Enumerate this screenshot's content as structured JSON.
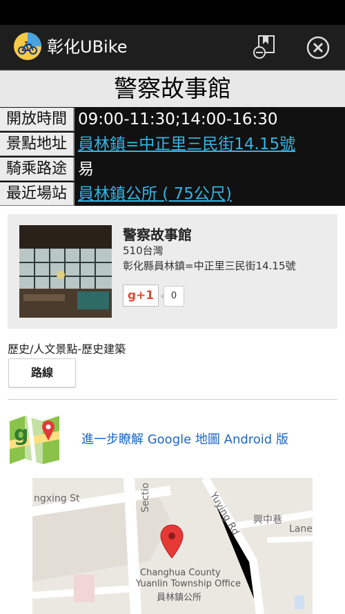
{
  "app": {
    "title": "彰化UBike"
  },
  "icons": {
    "app": "bicycle-app-icon",
    "bookmark": "bookmark-remove-icon",
    "close": "close-circle-icon",
    "maps": "google-maps-icon",
    "pin": "map-pin-icon"
  },
  "header": {
    "title": "警察故事館"
  },
  "info": {
    "rows": [
      {
        "label": "開放時間",
        "value": "09:00-11:30;14:00-16:30"
      },
      {
        "label": "景點地址",
        "value": "員林鎮=中正里三民街14.15號"
      },
      {
        "label": "騎乘路途",
        "value": "易"
      },
      {
        "label": "最近場站",
        "value": "員林鎮公所 ( 75公尺)"
      }
    ]
  },
  "card": {
    "name": "警察故事館",
    "zip": "510台灣",
    "address": "彰化縣員林鎮=中正里三民街14.15號",
    "gplus_label": "g+1",
    "gplus_count": "0"
  },
  "category": "歷史/人文景點-歷史建築",
  "route_button": "路線",
  "maps_link": "進一步瞭解 Google 地圖 Android 版",
  "map": {
    "street_1": "ngxing St",
    "street_2": "Sectio",
    "street_3": "Yuying Rd",
    "street_4": "興中巷",
    "street_5": "Lane",
    "place_en_1": "Changhua County",
    "place_en_2": "Yuanlin Township Office",
    "place_zh": "員林鎮公所"
  },
  "colors": {
    "link_cyan": "#33b5e5",
    "link_blue": "#1a66c9",
    "gplus_red": "#dd4b39",
    "pin_red": "#e53935"
  }
}
